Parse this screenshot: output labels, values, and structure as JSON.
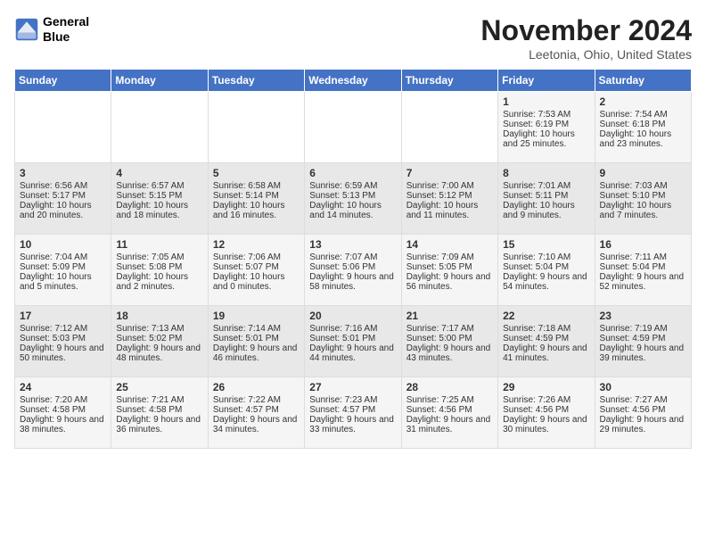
{
  "header": {
    "logo_line1": "General",
    "logo_line2": "Blue",
    "month_title": "November 2024",
    "location": "Leetonia, Ohio, United States"
  },
  "weekdays": [
    "Sunday",
    "Monday",
    "Tuesday",
    "Wednesday",
    "Thursday",
    "Friday",
    "Saturday"
  ],
  "weeks": [
    [
      {
        "day": "",
        "content": ""
      },
      {
        "day": "",
        "content": ""
      },
      {
        "day": "",
        "content": ""
      },
      {
        "day": "",
        "content": ""
      },
      {
        "day": "",
        "content": ""
      },
      {
        "day": "1",
        "content": "Sunrise: 7:53 AM\nSunset: 6:19 PM\nDaylight: 10 hours and 25 minutes."
      },
      {
        "day": "2",
        "content": "Sunrise: 7:54 AM\nSunset: 6:18 PM\nDaylight: 10 hours and 23 minutes."
      }
    ],
    [
      {
        "day": "3",
        "content": "Sunrise: 6:56 AM\nSunset: 5:17 PM\nDaylight: 10 hours and 20 minutes."
      },
      {
        "day": "4",
        "content": "Sunrise: 6:57 AM\nSunset: 5:15 PM\nDaylight: 10 hours and 18 minutes."
      },
      {
        "day": "5",
        "content": "Sunrise: 6:58 AM\nSunset: 5:14 PM\nDaylight: 10 hours and 16 minutes."
      },
      {
        "day": "6",
        "content": "Sunrise: 6:59 AM\nSunset: 5:13 PM\nDaylight: 10 hours and 14 minutes."
      },
      {
        "day": "7",
        "content": "Sunrise: 7:00 AM\nSunset: 5:12 PM\nDaylight: 10 hours and 11 minutes."
      },
      {
        "day": "8",
        "content": "Sunrise: 7:01 AM\nSunset: 5:11 PM\nDaylight: 10 hours and 9 minutes."
      },
      {
        "day": "9",
        "content": "Sunrise: 7:03 AM\nSunset: 5:10 PM\nDaylight: 10 hours and 7 minutes."
      }
    ],
    [
      {
        "day": "10",
        "content": "Sunrise: 7:04 AM\nSunset: 5:09 PM\nDaylight: 10 hours and 5 minutes."
      },
      {
        "day": "11",
        "content": "Sunrise: 7:05 AM\nSunset: 5:08 PM\nDaylight: 10 hours and 2 minutes."
      },
      {
        "day": "12",
        "content": "Sunrise: 7:06 AM\nSunset: 5:07 PM\nDaylight: 10 hours and 0 minutes."
      },
      {
        "day": "13",
        "content": "Sunrise: 7:07 AM\nSunset: 5:06 PM\nDaylight: 9 hours and 58 minutes."
      },
      {
        "day": "14",
        "content": "Sunrise: 7:09 AM\nSunset: 5:05 PM\nDaylight: 9 hours and 56 minutes."
      },
      {
        "day": "15",
        "content": "Sunrise: 7:10 AM\nSunset: 5:04 PM\nDaylight: 9 hours and 54 minutes."
      },
      {
        "day": "16",
        "content": "Sunrise: 7:11 AM\nSunset: 5:04 PM\nDaylight: 9 hours and 52 minutes."
      }
    ],
    [
      {
        "day": "17",
        "content": "Sunrise: 7:12 AM\nSunset: 5:03 PM\nDaylight: 9 hours and 50 minutes."
      },
      {
        "day": "18",
        "content": "Sunrise: 7:13 AM\nSunset: 5:02 PM\nDaylight: 9 hours and 48 minutes."
      },
      {
        "day": "19",
        "content": "Sunrise: 7:14 AM\nSunset: 5:01 PM\nDaylight: 9 hours and 46 minutes."
      },
      {
        "day": "20",
        "content": "Sunrise: 7:16 AM\nSunset: 5:01 PM\nDaylight: 9 hours and 44 minutes."
      },
      {
        "day": "21",
        "content": "Sunrise: 7:17 AM\nSunset: 5:00 PM\nDaylight: 9 hours and 43 minutes."
      },
      {
        "day": "22",
        "content": "Sunrise: 7:18 AM\nSunset: 4:59 PM\nDaylight: 9 hours and 41 minutes."
      },
      {
        "day": "23",
        "content": "Sunrise: 7:19 AM\nSunset: 4:59 PM\nDaylight: 9 hours and 39 minutes."
      }
    ],
    [
      {
        "day": "24",
        "content": "Sunrise: 7:20 AM\nSunset: 4:58 PM\nDaylight: 9 hours and 38 minutes."
      },
      {
        "day": "25",
        "content": "Sunrise: 7:21 AM\nSunset: 4:58 PM\nDaylight: 9 hours and 36 minutes."
      },
      {
        "day": "26",
        "content": "Sunrise: 7:22 AM\nSunset: 4:57 PM\nDaylight: 9 hours and 34 minutes."
      },
      {
        "day": "27",
        "content": "Sunrise: 7:23 AM\nSunset: 4:57 PM\nDaylight: 9 hours and 33 minutes."
      },
      {
        "day": "28",
        "content": "Sunrise: 7:25 AM\nSunset: 4:56 PM\nDaylight: 9 hours and 31 minutes."
      },
      {
        "day": "29",
        "content": "Sunrise: 7:26 AM\nSunset: 4:56 PM\nDaylight: 9 hours and 30 minutes."
      },
      {
        "day": "30",
        "content": "Sunrise: 7:27 AM\nSunset: 4:56 PM\nDaylight: 9 hours and 29 minutes."
      }
    ]
  ]
}
